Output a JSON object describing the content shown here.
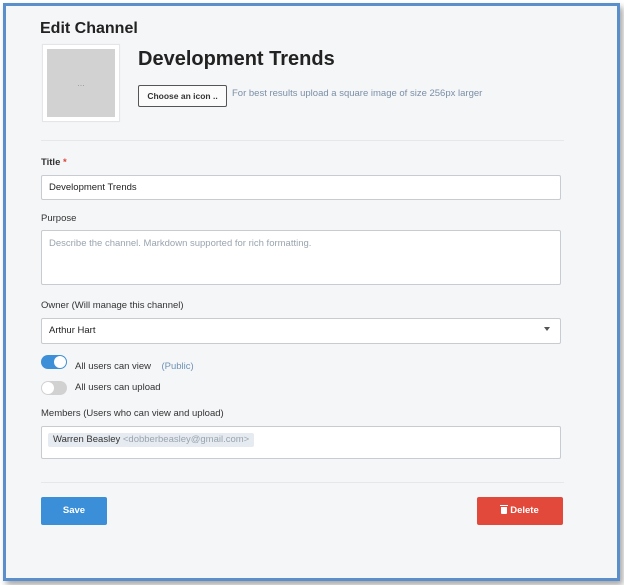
{
  "page": {
    "title": "Edit Channel"
  },
  "channel": {
    "name": "Development Trends",
    "icon_placeholder": "...",
    "choose_icon_label": "Choose an icon ..",
    "icon_hint": "For best results upload a square image of size 256px larger"
  },
  "form": {
    "title_label": "Title",
    "required_marker": "*",
    "title_value": "Development Trends",
    "purpose_label": "Purpose",
    "purpose_placeholder": "Describe the channel. Markdown supported for rich formatting.",
    "owner_label": "Owner (Will manage this channel)",
    "owner_value": "Arthur Hart",
    "view_toggle_label": "All users can view",
    "view_toggle_state": true,
    "view_toggle_note": "(Public)",
    "upload_toggle_label": "All users can upload",
    "upload_toggle_state": false,
    "members_label": "Members (Users who can view and upload)",
    "members": [
      {
        "name": "Warren Beasley",
        "email": "<dobberbeasley@gmail.com>"
      }
    ]
  },
  "actions": {
    "save_label": "Save",
    "delete_label": "Delete"
  },
  "colors": {
    "frame_border": "#5b8fcb",
    "primary": "#3a8fd8",
    "danger": "#e2493b",
    "required": "#d9433a"
  }
}
